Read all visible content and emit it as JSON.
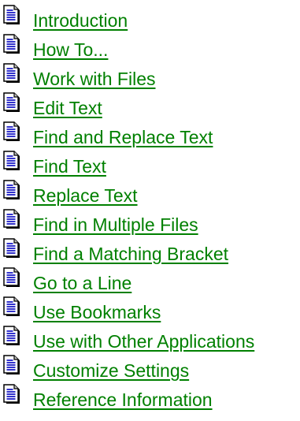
{
  "topics": {
    "icon": "document-page-icon",
    "link_color": "#008000",
    "items": [
      {
        "label": "Introduction"
      },
      {
        "label": "How To..."
      },
      {
        "label": "Work with Files"
      },
      {
        "label": "Edit Text"
      },
      {
        "label": "Find and Replace Text"
      },
      {
        "label": "Find Text"
      },
      {
        "label": "Replace Text"
      },
      {
        "label": "Find in Multiple Files"
      },
      {
        "label": "Find a Matching Bracket"
      },
      {
        "label": "Go to a Line"
      },
      {
        "label": "Use Bookmarks"
      },
      {
        "label": "Use with Other Applications"
      },
      {
        "label": "Customize Settings"
      },
      {
        "label": "Reference Information"
      }
    ]
  }
}
